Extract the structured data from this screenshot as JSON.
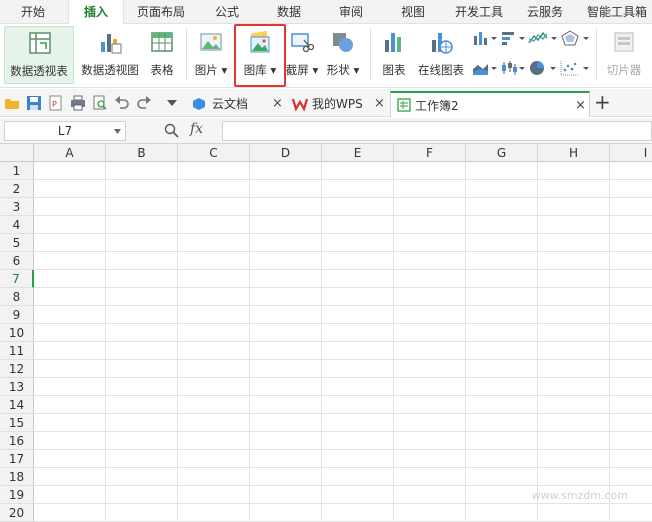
{
  "menu": {
    "tabs": [
      "开始",
      "插入",
      "页面布局",
      "公式",
      "数据",
      "审阅",
      "视图",
      "开发工具",
      "云服务",
      "智能工具箱"
    ],
    "active_index": 1
  },
  "ribbon": {
    "buttons": {
      "pivot_table": "数据透视表",
      "pivot_chart": "数据透视图",
      "table": "表格",
      "picture": "图片",
      "gallery": "图库",
      "screenshot": "截屏",
      "shapes": "形状",
      "chart": "图表",
      "online_chart": "在线图表",
      "slicer": "切片器"
    },
    "dropdown_arrow": "▾",
    "highlight_color": "#e2352b"
  },
  "doc_tabs": {
    "cloud_docs": "云文档",
    "my_wps": "我的WPS",
    "workbook": "工作簿2",
    "close_glyph": "×",
    "add_glyph": "+"
  },
  "formula_bar": {
    "cell_ref": "L7",
    "fx": "fx"
  },
  "grid": {
    "columns": [
      "A",
      "B",
      "C",
      "D",
      "E",
      "F",
      "G",
      "H",
      "I"
    ],
    "rows": [
      "1",
      "2",
      "3",
      "4",
      "5",
      "6",
      "7",
      "8",
      "9",
      "10",
      "11",
      "12",
      "13",
      "14",
      "15",
      "16",
      "17",
      "18",
      "19",
      "20"
    ],
    "selected_row": "7"
  },
  "watermark": "www.smzdm.com",
  "colors": {
    "accent_green": "#2aa147",
    "active_tab_text": "#1a7d2e",
    "wps_red": "#d9302b"
  }
}
